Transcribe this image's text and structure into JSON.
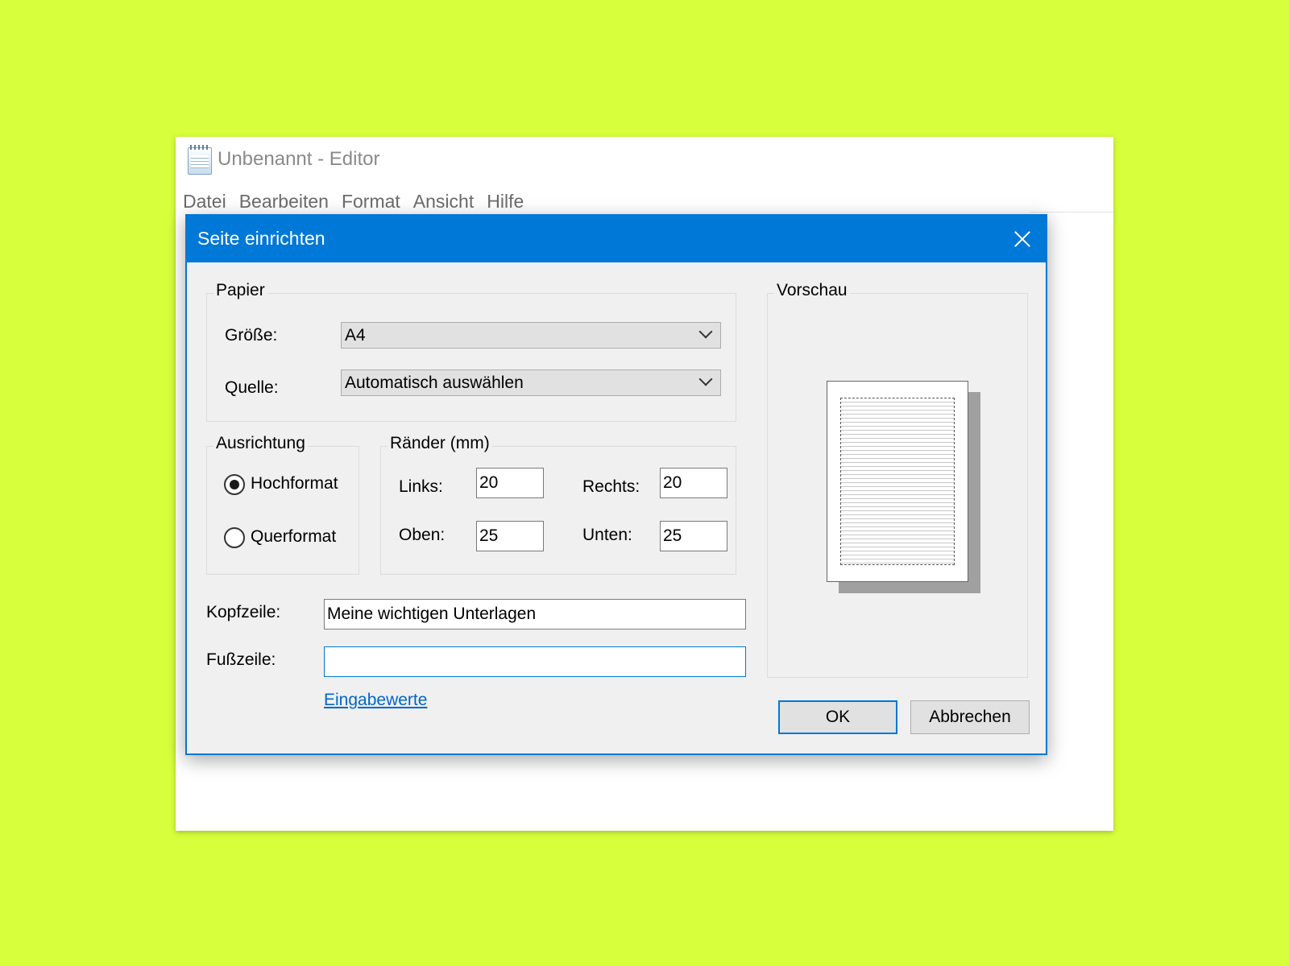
{
  "editor": {
    "title": "Unbenannt - Editor",
    "menu": [
      "Datei",
      "Bearbeiten",
      "Format",
      "Ansicht",
      "Hilfe"
    ]
  },
  "dialog": {
    "title": "Seite einrichten",
    "paper": {
      "group_label": "Papier",
      "size_label": "Größe:",
      "size_value": "A4",
      "source_label": "Quelle:",
      "source_value": "Automatisch auswählen"
    },
    "orientation": {
      "group_label": "Ausrichtung",
      "portrait_label": "Hochformat",
      "landscape_label": "Querformat",
      "selected": "Hochformat"
    },
    "margins": {
      "group_label": "Ränder (mm)",
      "left_label": "Links:",
      "left_value": "20",
      "right_label": "Rechts:",
      "right_value": "20",
      "top_label": "Oben:",
      "top_value": "25",
      "bottom_label": "Unten:",
      "bottom_value": "25"
    },
    "header_label": "Kopfzeile:",
    "header_value": "Meine wichtigen Unterlagen",
    "footer_label": "Fußzeile:",
    "footer_value": "",
    "input_values_link": "Eingabewerte",
    "preview_label": "Vorschau",
    "ok_label": "OK",
    "cancel_label": "Abbrechen"
  },
  "colors": {
    "background": "#d7ff3c",
    "accent": "#0078d7",
    "dialog_bg": "#f0f0f0",
    "link": "#0066cc"
  }
}
